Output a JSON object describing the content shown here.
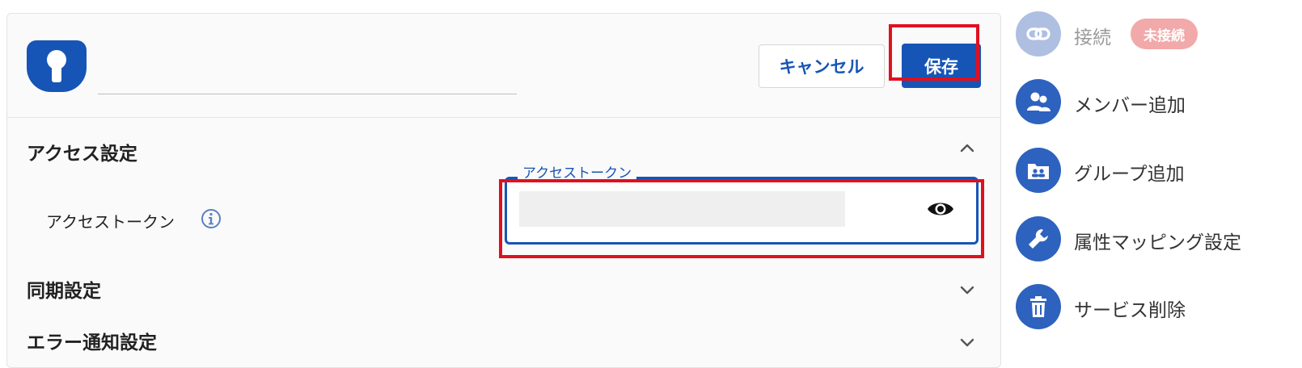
{
  "header": {
    "name_value": "",
    "cancel_label": "キャンセル",
    "save_label": "保存"
  },
  "sections": {
    "access": {
      "title": "アクセス設定",
      "expanded": true
    },
    "sync": {
      "title": "同期設定",
      "expanded": false
    },
    "error": {
      "title": "エラー通知設定",
      "expanded": false
    }
  },
  "access_token": {
    "row_label": "アクセストークン",
    "field_legend": "アクセストークン",
    "value": ""
  },
  "sidebar": {
    "connect_label": "接続",
    "connect_status": "未接続",
    "add_member_label": "メンバー追加",
    "add_group_label": "グループ追加",
    "attr_mapping_label": "属性マッピング設定",
    "delete_service_label": "サービス削除"
  },
  "icons": {
    "logo": "keyhole-logo",
    "info": "info-icon",
    "eye": "eye-icon",
    "connect": "link-icon",
    "member": "people-icon",
    "group": "group-folder-icon",
    "mapping": "wrench-icon",
    "delete": "trash-icon"
  },
  "colors": {
    "primary": "#1655b6",
    "highlight": "#e0101f",
    "badge": "#f2a9a9",
    "disabled_icon": "#aebfe2"
  }
}
